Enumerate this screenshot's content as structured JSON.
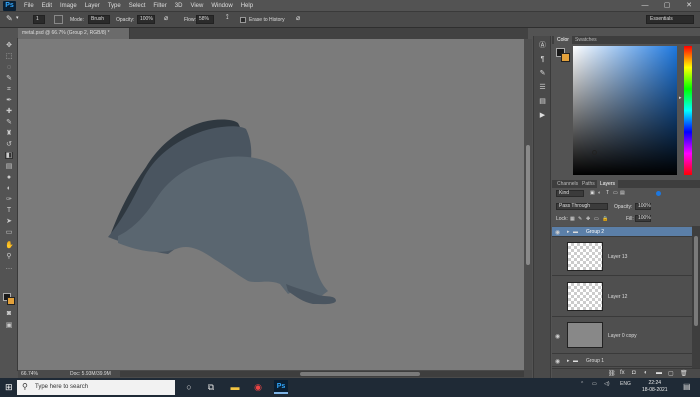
{
  "app": {
    "logo": "Ps"
  },
  "menu": [
    "File",
    "Edit",
    "Image",
    "Layer",
    "Type",
    "Select",
    "Filter",
    "3D",
    "View",
    "Window",
    "Help"
  ],
  "window_controls": [
    "—",
    "▢",
    "✕"
  ],
  "options": {
    "brush_size": "1",
    "mode_label": "Mode:",
    "mode_value": "Brush",
    "opacity_label": "Opacity:",
    "opacity_value": "100%",
    "flow_label": "Flow:",
    "flow_value": "58%",
    "erase_history": "Erase to History",
    "workspace": "Essentials"
  },
  "document": {
    "tab_title": "metal.psd @ 66.7% (Group 2, RGB/8) *",
    "zoom": "66.74%",
    "doc_info": "Doc: 5.93M/39.9M"
  },
  "color_panel": {
    "tabs": [
      "Color",
      "Swatches"
    ],
    "fg_color": "#1a1a1a",
    "bg_color": "#e3a13b",
    "hue_color": "#1d78e0"
  },
  "layers_panel": {
    "tabs": [
      "Channels",
      "Paths",
      "Layers"
    ],
    "kind_label": "Kind",
    "blend_mode": "Pass Through",
    "opacity_label": "Opacity:",
    "opacity_value": "100%",
    "lock_label": "Lock:",
    "fill_label": "Fill:",
    "fill_value": "100%",
    "layers": [
      {
        "name": "Group 2"
      },
      {
        "name": "Layer 13"
      },
      {
        "name": "Layer 12"
      },
      {
        "name": "Layer 0 copy"
      },
      {
        "name": "Group 1"
      }
    ],
    "footer_icons": [
      "link-icon",
      "fx-icon",
      "mask-icon",
      "adjustment-icon",
      "folder-icon",
      "new-layer-icon",
      "trash-icon"
    ]
  },
  "shape_colors": {
    "dark": "#2f3840",
    "mid": "#4a5560",
    "light": "#5a6670"
  },
  "taskbar": {
    "search_placeholder": "Type here to search",
    "language": "ENG",
    "time": "22:24",
    "date": "18-08-2021"
  }
}
